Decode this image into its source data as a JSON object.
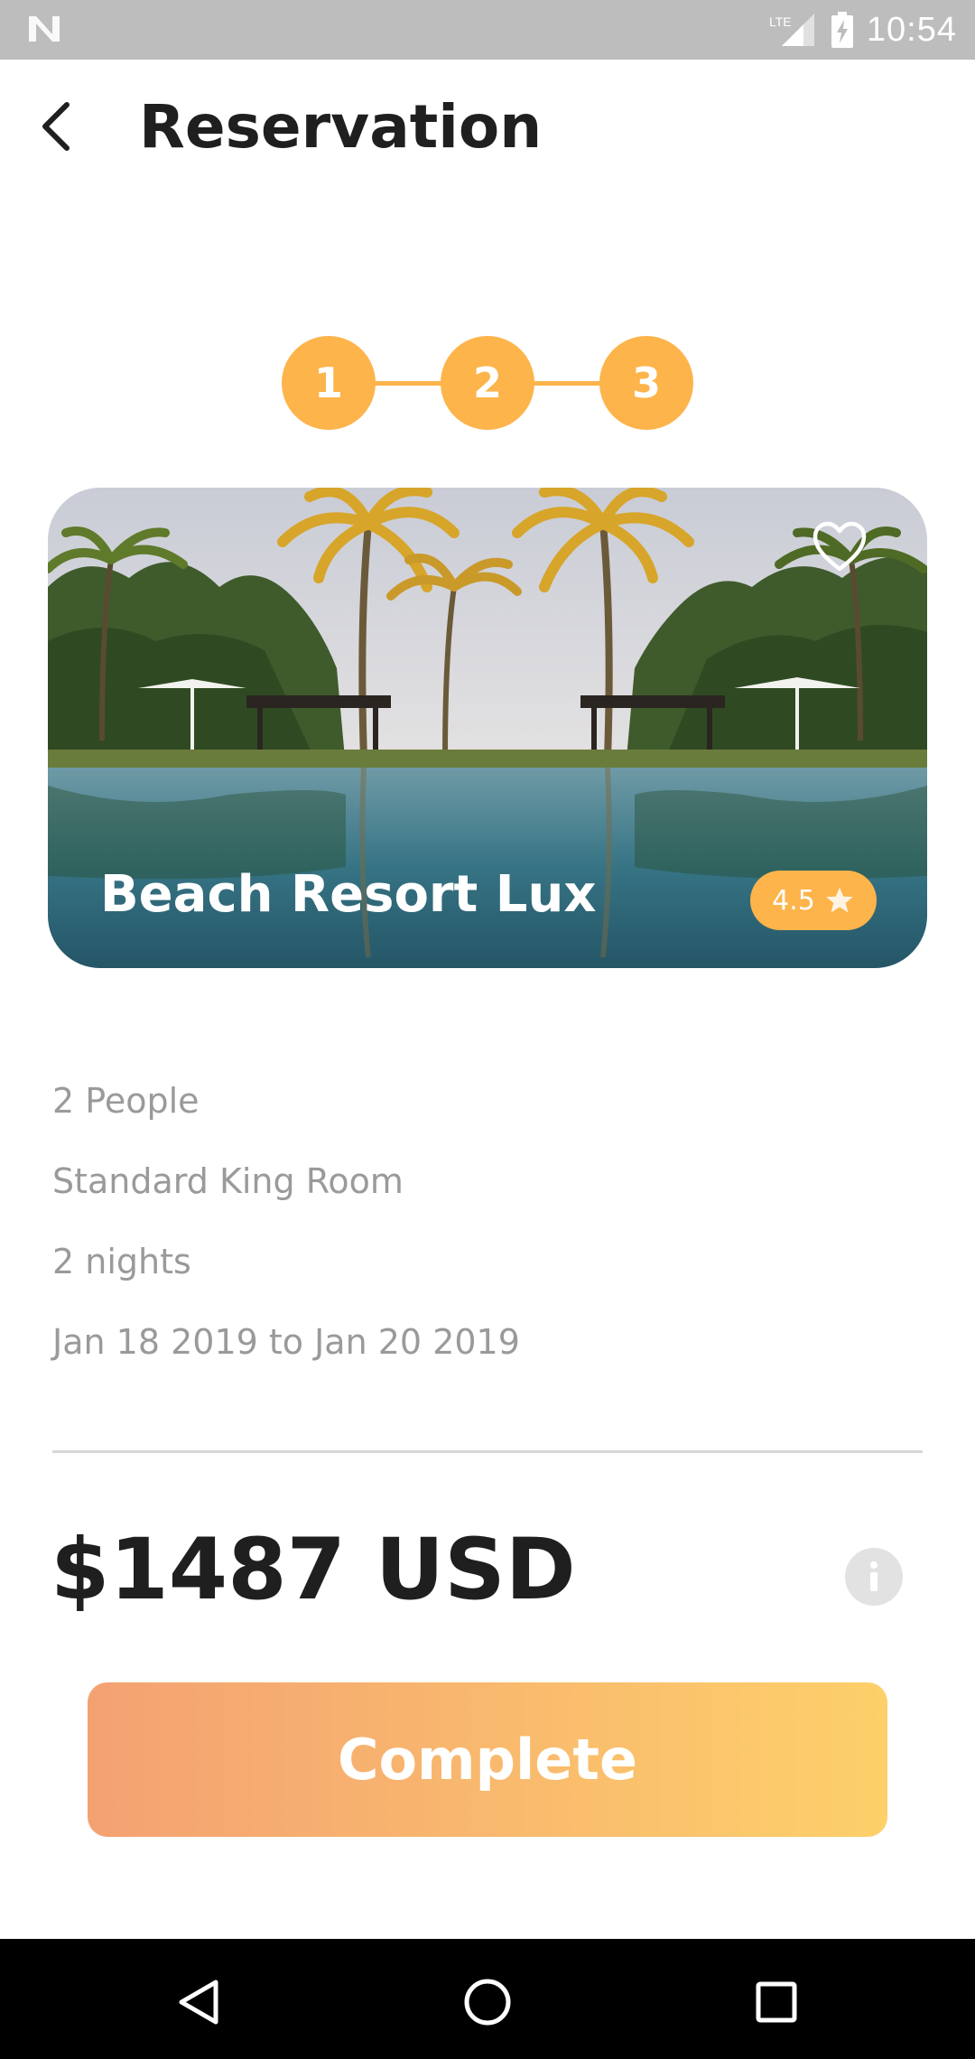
{
  "status_bar": {
    "network": "LTE",
    "time": "10:54",
    "icons": [
      "notification-n-icon",
      "signal-icon",
      "battery-charging-icon"
    ]
  },
  "header": {
    "title": "Reservation",
    "back_icon": "chevron-left-icon"
  },
  "stepper": {
    "steps": [
      "1",
      "2",
      "3"
    ],
    "completed_steps": 3
  },
  "hotel": {
    "name": "Beach Resort Lux",
    "rating": "4.5",
    "favorite_icon": "heart-outline-icon",
    "rating_icon": "star-icon"
  },
  "details": {
    "people": "2 People",
    "room": "Standard King Room",
    "nights": "2 nights",
    "dates": "Jan 18 2019 to Jan 20 2019"
  },
  "price": {
    "total": "$1487 USD",
    "info_icon": "info-icon"
  },
  "actions": {
    "complete_label": "Complete"
  },
  "nav_bar": {
    "icons": [
      "back-triangle-icon",
      "home-circle-icon",
      "recents-square-icon"
    ]
  },
  "colors": {
    "accent": "#fdb44b",
    "gradient_start": "#f4a172",
    "gradient_end": "#fdd06a",
    "text_primary": "#1f1f1f",
    "text_secondary": "#9a9a9a"
  }
}
